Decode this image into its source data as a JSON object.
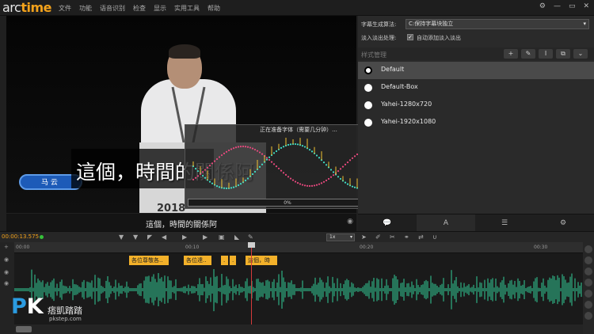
{
  "app": {
    "logo_prefix": "arc",
    "logo_suffix": "time",
    "menu": [
      "文件",
      "功能",
      "语音识别",
      "检查",
      "显示",
      "实用工具",
      "帮助"
    ],
    "window_controls": [
      "⚙",
      "—",
      "▭",
      "✕"
    ]
  },
  "video": {
    "subtitle": "這個，時間的關係阿",
    "podium_text": "2018 ",
    "name_badge": "马 云",
    "caption_below": "這個，時間的關係阿"
  },
  "progress_dialog": {
    "title": "正在准备字体（需要几分钟）...",
    "percent": "0%",
    "close_symbol": "✖",
    "progress": 0
  },
  "right_panel": {
    "algo_label": "字幕生成算法:",
    "algo_value": "C:保持字幕块独立",
    "fade_label": "淡入淡出处理:",
    "fade_checked": true,
    "fade_option": "自动添加淡入淡出",
    "style_manage": "样式管理",
    "tools": [
      "+",
      "✎",
      "I",
      "⧉",
      "⌄"
    ],
    "styles": [
      "Default",
      "Default-Box",
      "Yahei-1280x720",
      "Yahei-1920x1080"
    ],
    "tabs": [
      "💬",
      "A",
      "☰",
      "⚙"
    ]
  },
  "timeline": {
    "timecode": "00:00:13.575",
    "speed": "1x",
    "ruler": [
      "00:00",
      "00:10",
      "00:20",
      "00:30"
    ],
    "subtitle_blocks": [
      {
        "text": "各位尊敬各.."
      },
      {
        "text": "各位達.."
      },
      {
        "text": "."
      },
      {
        "text": "."
      },
      {
        "text": "這個，時"
      }
    ]
  },
  "watermark": {
    "pk_p": "P",
    "pk_k": "K",
    "name": "痞凱踏踏",
    "site": "pkstep.com"
  },
  "colors": {
    "accent": "#f3a21b",
    "waveform": "#2fb084",
    "playhead": "#d63b3b",
    "subtitle_block": "#f3b12a"
  }
}
